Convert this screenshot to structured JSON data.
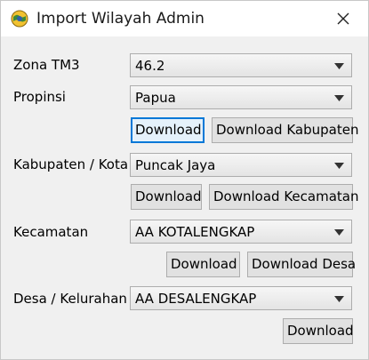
{
  "window": {
    "title": "Import Wilayah Admin",
    "icon": "qgis-globe-icon",
    "close_icon": "close-icon"
  },
  "zona": {
    "label": "Zona TM3",
    "value": "46.2"
  },
  "propinsi": {
    "label": "Propinsi",
    "value": "Papua",
    "download_label": "Download",
    "download_sub_label": "Download Kabupaten"
  },
  "kabupaten": {
    "label": "Kabupaten / Kota",
    "value": "Puncak Jaya",
    "download_label": "Download",
    "download_sub_label": "Download Kecamatan"
  },
  "kecamatan": {
    "label": "Kecamatan",
    "value": "AA KOTALENGKAP",
    "download_label": "Download",
    "download_sub_label": "Download Desa"
  },
  "desa": {
    "label": "Desa / Kelurahan",
    "value": "AA DESALENGKAP",
    "download_label": "Download"
  },
  "colors": {
    "focus_border": "#0078d7",
    "focus_fill": "#e5f1fb",
    "button_fill": "#e1e1e1",
    "dialog_bg": "#f0f0f0"
  }
}
